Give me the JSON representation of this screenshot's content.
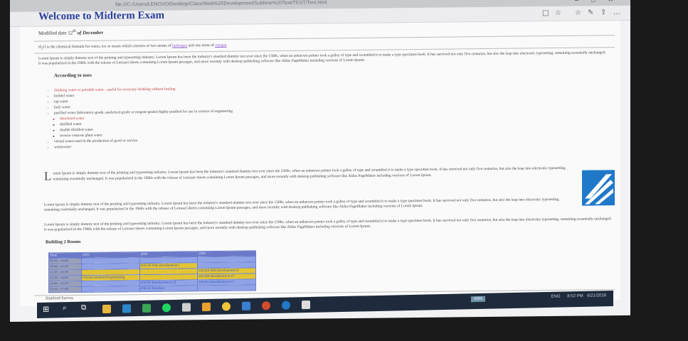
{
  "window": {
    "path": "file:///C:/Users/LENOVO/Desktop/Class/Web%20Development/Sublime%20Text/TEST/Test.html"
  },
  "page": {
    "title": "Welcome to Midterm Exam",
    "modified_prefix": "Modified date 12",
    "modified_sup": "th",
    "modified_suffix": " of December",
    "intro_a": "H",
    "intro_b": "2",
    "intro_c": "O is the chemical formula for water, ice or steam which consists of two atoms of ",
    "intro_link1": "hydrogen",
    "intro_d": " and one atom of ",
    "intro_link2": "oxygen",
    "lorem1": "Lorem Ipsum is simply dummy text of the printing and typesetting industry. Lorem Ipsum has been the industry's standard dummy text ever since the 1500s, when an unknown printer took a galley of type and scrambled it to make a type specimen book. It has survived not only five centuries, but also the leap into electronic typesetting, remaining essentially unchanged. It was popularised in the 1960s with the release of Letraset sheets containing Lorem Ipsum passages, and more recently with desktop publishing software like Aldus PageMaker including versions of Lorem Ipsum.",
    "uses_heading": "According to uses",
    "uses": [
      "drinking water or portable water - useful for everyday drinking without fouling",
      "bottled water",
      "tap water",
      "holy water",
      "purified water (laboratory-grade, analytical-grade or reagent-grade)-highly purified for use in science of engineering"
    ],
    "purified_sub": [
      "deionized water",
      "distilled water",
      "double distilled water",
      "reverse osmosis plant water"
    ],
    "uses_tail": [
      "virtual water-used in the production of good or service",
      "wastewater"
    ],
    "dropcap": "L",
    "lorem2": "orem Ipsum is simply dummy text of the printing and typesetting industry. Lorem Ipsum has been the industry's standard dummy text ever since the 1500s, when an unknown printer took a galley of type and scrambled it to make a type specimen book. It has survived not only five centuries, but also the leap into electronic typesetting, remaining essentially unchanged. It was popularised in the 1960s with the release of Letraset sheets containing Lorem Ipsum passages, and more recently with desktop publishing software like Aldus PageMaker including versions of Lorem Ipsum.",
    "lorem3": "Lorem Ipsum is simply dummy text of the printing and typesetting industry. Lorem Ipsum has been the industry's standard dummy text ever since the 1500s, when an unknown printer took a galley of type and scrambled it to make a type specimen book. It has survived not only five centuries, but also the leap into electronic typesetting, remaining essentially unchanged. It was popularised in the 1960s with the release of Letraset sheets containing Lorem Ipsum passages, and more recently with desktop publishing software like Aldus PageMaker including versions of Lorem Ipsum.",
    "lorem4": "Lorem Ipsum is simply dummy text of the printing and typesetting industry. Lorem Ipsum has been the industry's standard dummy text ever since the 1500s, when an unknown printer took a galley of type and scrambled it to make a type specimen book. It has survived not only five centuries, but also the leap into electronic typesetting, remaining essentially unchanged. It was popularised in the 1960s with the release of Letraset sheets containing Lorem Ipsum passages, and more recently with desktop publishing software like Aldus PageMaker including versions of Lorem Ipsum.",
    "building_heading": "Building 2 Rooms",
    "table_header": [
      "Time",
      "2503",
      "2505",
      "2506"
    ],
    "table_rows": [
      [
        "08:30 - 10:00",
        "",
        "",
        ""
      ],
      [
        "10:00 - 11:30",
        "",
        "ITE120 Web Development I",
        ""
      ],
      [
        "11:30 - 12:30",
        "",
        "",
        "ITE220 Web Development II"
      ],
      [
        "12:30 - 14:00",
        "ITE343 Android Programming",
        "",
        "ITE100 Introduction to IT"
      ],
      [
        "14:00 - 15:30",
        "",
        "ITE101 Introduction to IT",
        "ITE101 Introduction to IT"
      ],
      [
        "15:30 - 17:00",
        "",
        "ITE141 Database",
        ""
      ]
    ],
    "footer": "Stanford Survey"
  },
  "taskbar": {
    "battery": "43%",
    "lang": "ENG",
    "time": "8:52 PM",
    "date": "6/21/2018"
  },
  "colors": {
    "title": "#2a3f9a",
    "link": "#8a5cd0",
    "table_header": "#6c79c8",
    "highlight": "#e3c533",
    "taskbar": "#1f2b3c"
  }
}
